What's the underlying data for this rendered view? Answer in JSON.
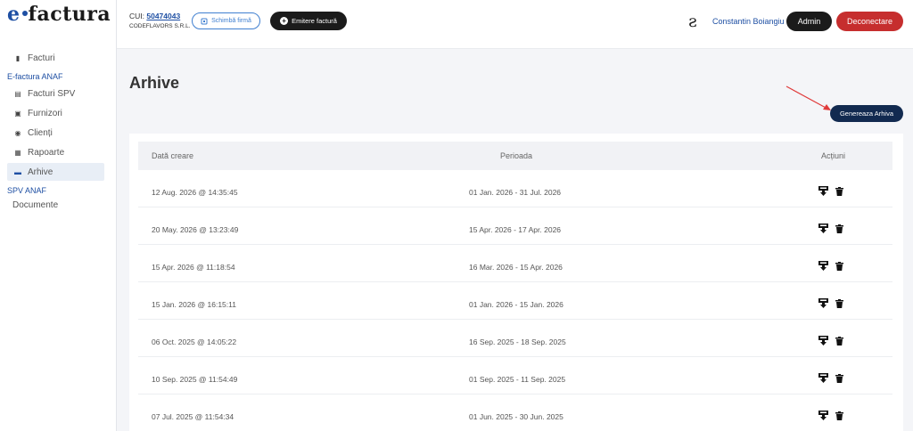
{
  "brand": {
    "logo_e": "e",
    "logo_rest": "factura"
  },
  "sidebar": {
    "items": [
      {
        "label": "Facturi",
        "icon": "invoice-icon"
      },
      {
        "section": "E-factura ANAF"
      },
      {
        "label": "Facturi SPV",
        "icon": "invoice-list-icon"
      },
      {
        "label": "Furnizori",
        "icon": "supplier-icon"
      },
      {
        "label": "Clienți",
        "icon": "clients-icon"
      },
      {
        "label": "Rapoarte",
        "icon": "reports-icon"
      },
      {
        "label": "Arhive",
        "icon": "archive-icon",
        "active": true
      },
      {
        "section": "SPV ANAF"
      },
      {
        "label": "Documente"
      }
    ]
  },
  "topbar": {
    "cui_label": "CUI:",
    "cui_value": "50474043",
    "company_name": "CODEFLAVORS S.R.L.",
    "switch_company_label": "Schimbă firmă",
    "emit_invoice_label": "Emitere factură",
    "user_name": "Constantin Boiangiu",
    "admin_label": "Admin",
    "logout_label": "Deconectare"
  },
  "main": {
    "title": "Arhive",
    "generate_button_label": "Genereaza Arhiva",
    "table": {
      "headers": [
        "Dată creare",
        "Perioada",
        "Acțiuni"
      ],
      "rows": [
        {
          "created": "12 Aug. 2026 @ 14:35:45",
          "period": "01 Jan. 2026 - 31 Jul. 2026"
        },
        {
          "created": "20 May. 2026 @ 13:23:49",
          "period": "15 Apr. 2026 - 17 Apr. 2026"
        },
        {
          "created": "15 Apr. 2026 @ 11:18:54",
          "period": "16 Mar. 2026 - 15 Apr. 2026"
        },
        {
          "created": "15 Jan. 2026 @ 16:15:11",
          "period": "01 Jan. 2026 - 15 Jan. 2026"
        },
        {
          "created": "06 Oct. 2025 @ 14:05:22",
          "period": "16 Sep. 2025 - 18 Sep. 2025"
        },
        {
          "created": "10 Sep. 2025 @ 11:54:49",
          "period": "01 Sep. 2025 - 11 Sep. 2025"
        },
        {
          "created": "07 Jul. 2025 @ 11:54:34",
          "period": "01 Jun. 2025 - 30 Jun. 2025"
        }
      ]
    }
  },
  "colors": {
    "brand_blue": "#1e4fa3",
    "dark_button": "#1b1b1b",
    "logout_red": "#c62e2e",
    "generate_navy": "#122a50",
    "annotation_arrow": "#e03b3b"
  }
}
